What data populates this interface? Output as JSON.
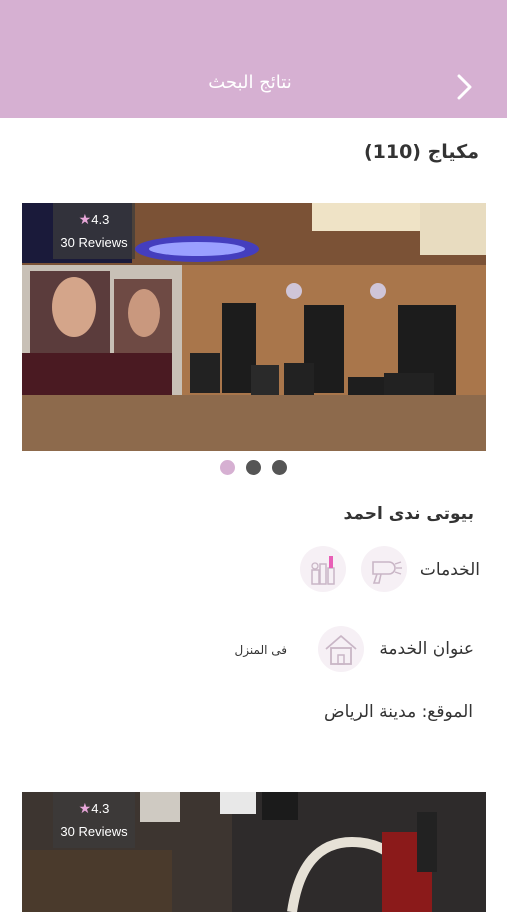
{
  "header": {
    "title": "نتائج البحث",
    "back_icon": "chevron-right-icon",
    "color": "#d6b0d2"
  },
  "results": {
    "title": "مكياج (110)"
  },
  "cards": [
    {
      "rating": "4.3",
      "reviews": "30 Reviews",
      "image": "salon-interior-photo",
      "carousel": {
        "count": 3,
        "active_index": 0
      },
      "name": "بيوتى ندى احمد",
      "services_label": "الخدمات",
      "service_icons": [
        "hair-dryer-icon",
        "makeup-kit-icon"
      ],
      "address_label": "عنوان الخدمة",
      "address_icon": "home-icon",
      "address_value": "فى المنزل",
      "location": "الموقع: مدينة الرياض"
    },
    {
      "rating": "4.3",
      "reviews": "30 Reviews",
      "image": "salon-interior-photo"
    }
  ]
}
